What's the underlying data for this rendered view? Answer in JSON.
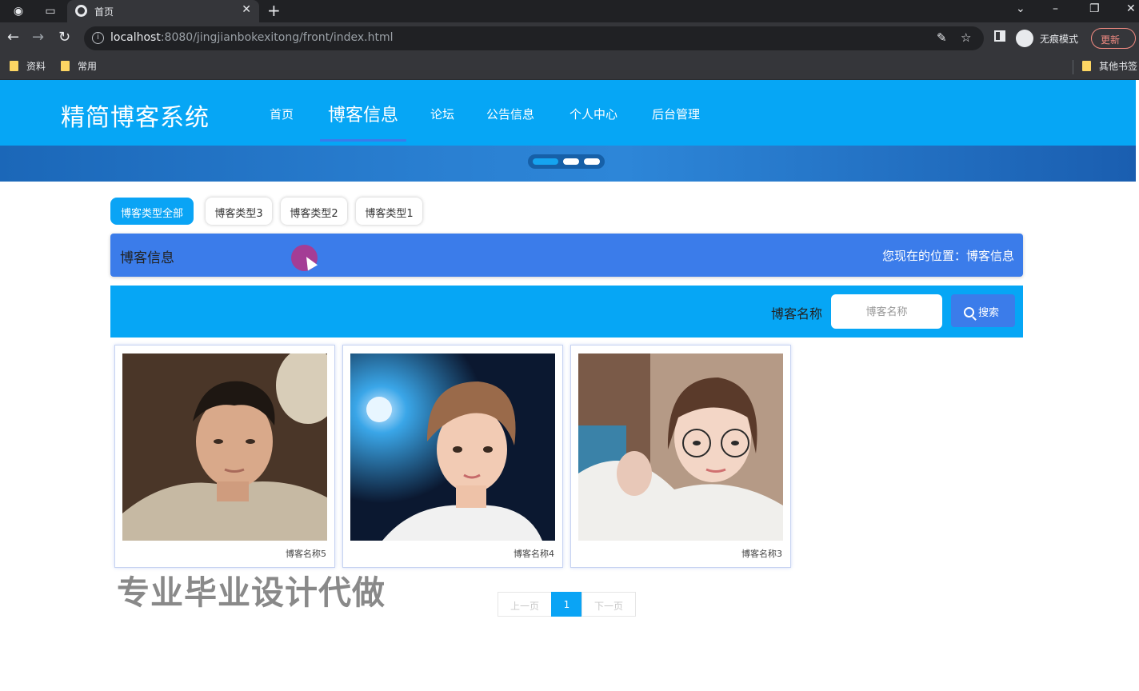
{
  "browser": {
    "tab_title": "首页",
    "close_glyph": "✕",
    "new_tab_glyph": "+",
    "url_host": "localhost",
    "url_rest": ":8080/jingjianbokexitong/front/index.html",
    "incognito_label": "无痕模式",
    "update_label": "更新",
    "bookmarks": [
      "资料",
      "常用"
    ],
    "other_bookmarks": "其他书签"
  },
  "site": {
    "logo": "精简博客系统",
    "nav": [
      "首页",
      "博客信息",
      "论坛",
      "公告信息",
      "个人中心",
      "后台管理"
    ],
    "active_nav_index": 1,
    "carousel_active_dot": 0
  },
  "filters": [
    "博客类型全部",
    "博客类型3",
    "博客类型2",
    "博客类型1"
  ],
  "info_bar": {
    "title": "博客信息",
    "breadcrumb": "您现在的位置：博客信息"
  },
  "search": {
    "label": "博客名称",
    "placeholder": "博客名称",
    "button": "搜索"
  },
  "cards": [
    {
      "caption": "博客名称5",
      "image": "young-man-beige-shirt-photo"
    },
    {
      "caption": "博客名称4",
      "image": "young-man-stage-lights-photo"
    },
    {
      "caption": "博客名称3",
      "image": "girl-round-glasses-photo"
    }
  ],
  "pagination": {
    "prev": "上一页",
    "current": "1",
    "next": "下一页"
  },
  "watermark": "专业毕业设计代做",
  "colors": {
    "header_blue": "#06a6f5",
    "accent_blue": "#3b7cea",
    "chrome_dark": "#202124"
  }
}
